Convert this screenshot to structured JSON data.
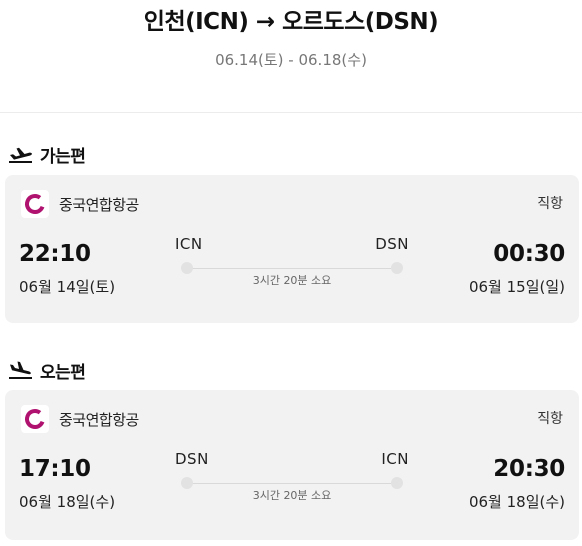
{
  "header": {
    "title": "인천(ICN) → 오르도스(DSN)",
    "dates": "06.14(토) - 06.18(수)"
  },
  "outbound": {
    "label": "가는편",
    "icon": "airplane-takeoff-icon",
    "airline": "중국연합항공",
    "flight_type": "직항",
    "dep_time": "22:10",
    "dep_date": "06월 14일(토)",
    "dep_code": "ICN",
    "arr_code": "DSN",
    "duration": "3시간 20분 소요",
    "arr_time": "00:30",
    "arr_date": "06월 15일(일)"
  },
  "inbound": {
    "label": "오는편",
    "icon": "airplane-landing-icon",
    "airline": "중국연합항공",
    "flight_type": "직항",
    "dep_time": "17:10",
    "dep_date": "06월 18일(수)",
    "dep_code": "DSN",
    "arr_code": "ICN",
    "duration": "3시간 20분 소요",
    "arr_time": "20:30",
    "arr_date": "06월 18일(수)"
  },
  "colors": {
    "airline_logo": "#b0126f",
    "card_bg": "#f2f2f2"
  }
}
